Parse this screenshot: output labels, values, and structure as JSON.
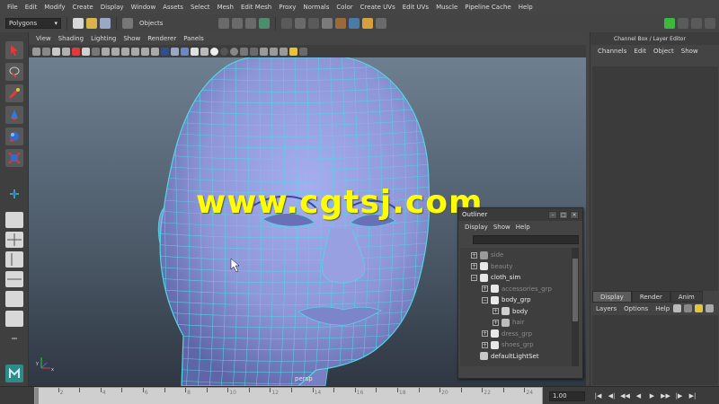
{
  "menubar": {
    "items": [
      "File",
      "Edit",
      "Modify",
      "Create",
      "Display",
      "Window",
      "Assets",
      "Select",
      "Mesh",
      "Edit Mesh",
      "Proxy",
      "Normals",
      "Color",
      "Create UVs",
      "Edit UVs",
      "Muscle",
      "Pipeline Cache",
      "Help"
    ]
  },
  "statusline": {
    "menuset": "Polygons",
    "selection_mode": "Objects"
  },
  "viewport": {
    "menu": [
      "View",
      "Shading",
      "Lighting",
      "Show",
      "Renderer",
      "Panels"
    ],
    "camera_label": "persp"
  },
  "watermark": "www.cgtsj.com",
  "channel_box": {
    "title": "Channel Box / Layer Editor",
    "menu": [
      "Channels",
      "Edit",
      "Object",
      "Show"
    ]
  },
  "layer_editor": {
    "tabs": [
      "Display",
      "Render",
      "Anim"
    ],
    "active_tab": "Display",
    "menu": [
      "Layers",
      "Options",
      "Help"
    ]
  },
  "outliner": {
    "title": "Outliner",
    "menu": [
      "Display",
      "Show",
      "Help"
    ],
    "items": [
      {
        "label": "side",
        "expander": "+"
      },
      {
        "label": "beauty",
        "expander": "+"
      },
      {
        "label": "cloth_sim",
        "expander": "−"
      },
      {
        "label": "accessories_grp",
        "expander": "+"
      },
      {
        "label": "body_grp",
        "expander": "−"
      },
      {
        "label": "body",
        "expander": "+"
      },
      {
        "label": "hair",
        "expander": "+"
      },
      {
        "label": "dress_grp",
        "expander": "+"
      },
      {
        "label": "shoes_grp",
        "expander": "+"
      },
      {
        "label": "defaultLightSet",
        "expander": ""
      }
    ]
  },
  "timeline": {
    "ticks": [
      "2",
      "4",
      "6",
      "8",
      "10",
      "12",
      "14",
      "16",
      "18",
      "20",
      "22",
      "24"
    ],
    "current_frame": "1.00"
  },
  "colors": {
    "mesh": "#8f98d8",
    "wire": "#52d6e6",
    "watermark": "#ffff00",
    "selected_text": "#eeeeee"
  }
}
